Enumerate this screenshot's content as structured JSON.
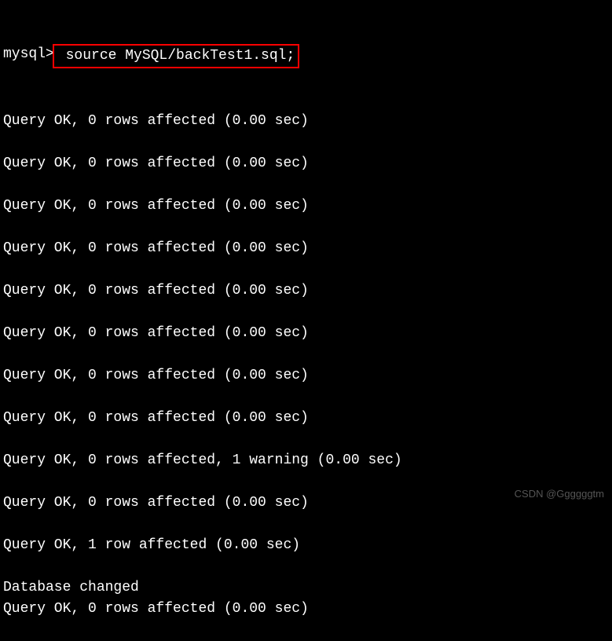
{
  "prompt": "mysql>",
  "command": " source MySQL/backTest1.sql;",
  "lines": [
    "Query OK, 0 rows affected (0.00 sec)",
    "",
    "Query OK, 0 rows affected (0.00 sec)",
    "",
    "Query OK, 0 rows affected (0.00 sec)",
    "",
    "Query OK, 0 rows affected (0.00 sec)",
    "",
    "Query OK, 0 rows affected (0.00 sec)",
    "",
    "Query OK, 0 rows affected (0.00 sec)",
    "",
    "Query OK, 0 rows affected (0.00 sec)",
    "",
    "Query OK, 0 rows affected (0.00 sec)",
    "",
    "Query OK, 0 rows affected, 1 warning (0.00 sec)",
    "",
    "Query OK, 0 rows affected (0.00 sec)",
    "",
    "Query OK, 1 row affected (0.00 sec)",
    "",
    "Database changed",
    "Query OK, 0 rows affected (0.00 sec)"
  ],
  "watermark": "CSDN @Ggggggtm"
}
